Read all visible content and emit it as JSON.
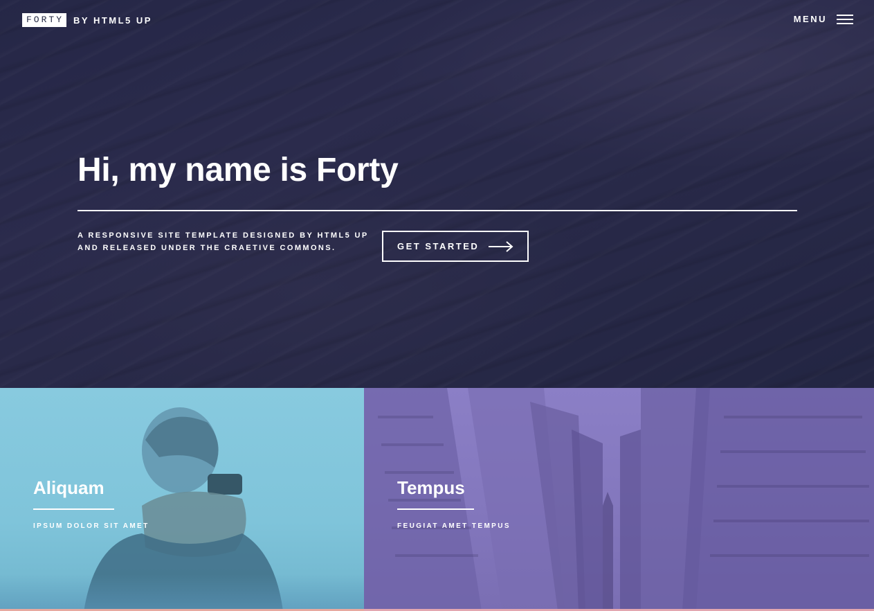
{
  "header": {
    "logo_label": "FORTY",
    "logo_byline": "BY HTML5 UP",
    "menu_label": "MENU",
    "menu_icon": "hamburger-icon"
  },
  "hero": {
    "title": "Hi, my name is Forty",
    "subtitle_line1": "A RESPONSIVE SITE TEMPLATE DESIGNED BY HTML5 UP",
    "subtitle_line2": "AND RELEASED UNDER THE CRAETIVE COMMONS.",
    "cta_label": "GET STARTED",
    "cta_icon": "arrow-right-icon",
    "background_color": "#242943"
  },
  "tiles": [
    {
      "title": "Aliquam",
      "subtitle": "IPSUM DOLOR SIT AMET",
      "color": "#87c9de"
    },
    {
      "title": "Tempus",
      "subtitle": "FEUGIAT AMET TEMPUS",
      "color": "#8a7ec4"
    }
  ]
}
